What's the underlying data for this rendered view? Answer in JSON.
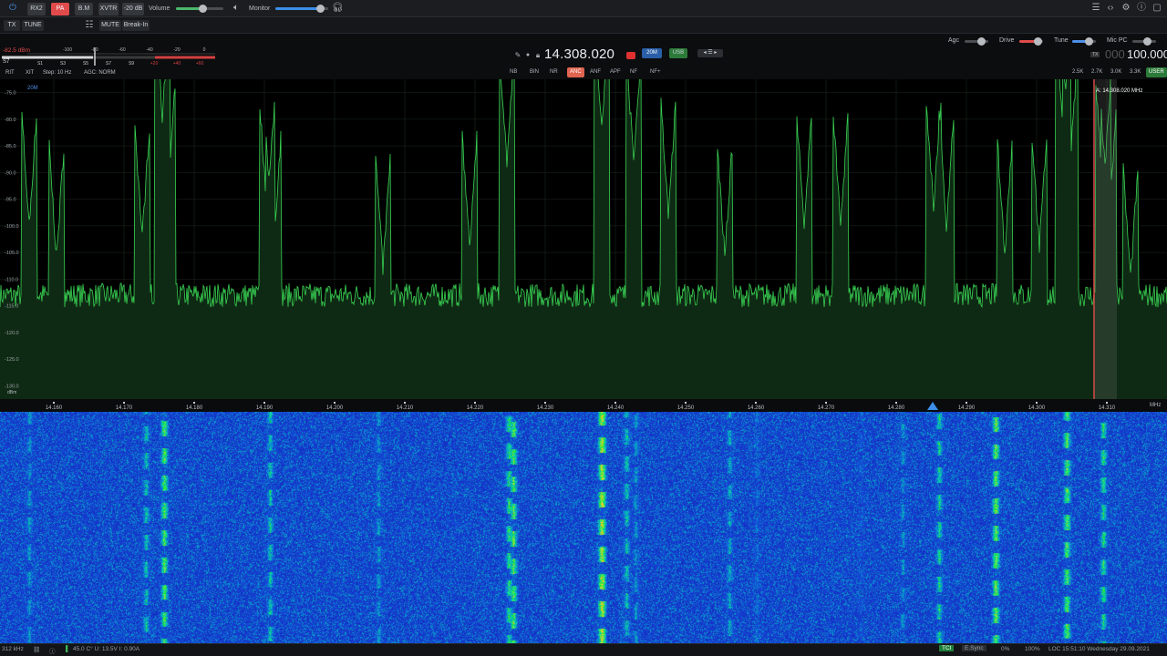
{
  "toolbar": {
    "rx2": "RX2",
    "pa": "PA",
    "bm": "B.M",
    "xvtr": "XVTR",
    "atten": "-20 dB",
    "volume_label": "Volume",
    "volume_level": 0.55,
    "monitor_label": "Monitor",
    "monitor_level": 0.85
  },
  "row2": {
    "tx": "TX",
    "tune": "TUNE",
    "mute": "MUTE",
    "breakin": "Break-In",
    "agc_label": "Agc",
    "drive_label": "Drive",
    "tune_label": "Tune",
    "mic_label": "Mic PC"
  },
  "meter": {
    "dbm": "-82.5 dBm",
    "s_reading": "S7",
    "scale_top": [
      "-100",
      "-80",
      "-60",
      "-40",
      "-20",
      "0"
    ],
    "scale_bottom": [
      "S1",
      "S3",
      "S5",
      "S7",
      "S9",
      "+20",
      "+40",
      "+60"
    ],
    "rit": "RIT",
    "xit": "XIT",
    "step": "Step: 10 Hz",
    "agc": "AGC: NORM"
  },
  "vfo": {
    "frequency": "14.308.020",
    "band": "20M",
    "mode": "USB",
    "sub_frequency": "100.000",
    "sub_prefix": "000",
    "dsp": [
      "NB",
      "BIN",
      "NR",
      "ANC",
      "ANF",
      "APF",
      "NF",
      "NF+"
    ],
    "dsp_active": "ANC",
    "filters": [
      "2.5K",
      "2.7K",
      "3.0K",
      "3.3K",
      "USER"
    ]
  },
  "spectrum": {
    "band_tag": "20M",
    "marker_label": "A: 14.308.020 MHz",
    "db_labels": [
      "-75.0",
      "-80.0",
      "-85.0",
      "-90.0",
      "-95.0",
      "-100.0",
      "-105.0",
      "-110.0",
      "-115.0",
      "-120.0",
      "-125.0",
      "-130.0"
    ],
    "db_unit": "dBm",
    "freq_labels": [
      "14.160",
      "14.170",
      "14.180",
      "14.190",
      "14.200",
      "14.210",
      "14.220",
      "14.230",
      "14.240",
      "14.250",
      "14.260",
      "14.270",
      "14.280",
      "14.290",
      "14.300",
      "14.310"
    ],
    "freq_unit": "MHz",
    "colors": {
      "trace": "#39d353",
      "fill": "#0f2a14",
      "marker": "#e34848",
      "waterfall_bg": "#1a2fc8"
    }
  },
  "status": {
    "left_rate": "312 kHz",
    "temp_volt": "45.0 C°  U: 13.5V  I: 0.90A",
    "tci": "TCI",
    "esync": "E.Sync",
    "cpu": "0%",
    "zoom": "100%",
    "loc_time": "LOC 15:51:10 Wednesday 29.09.2021"
  }
}
